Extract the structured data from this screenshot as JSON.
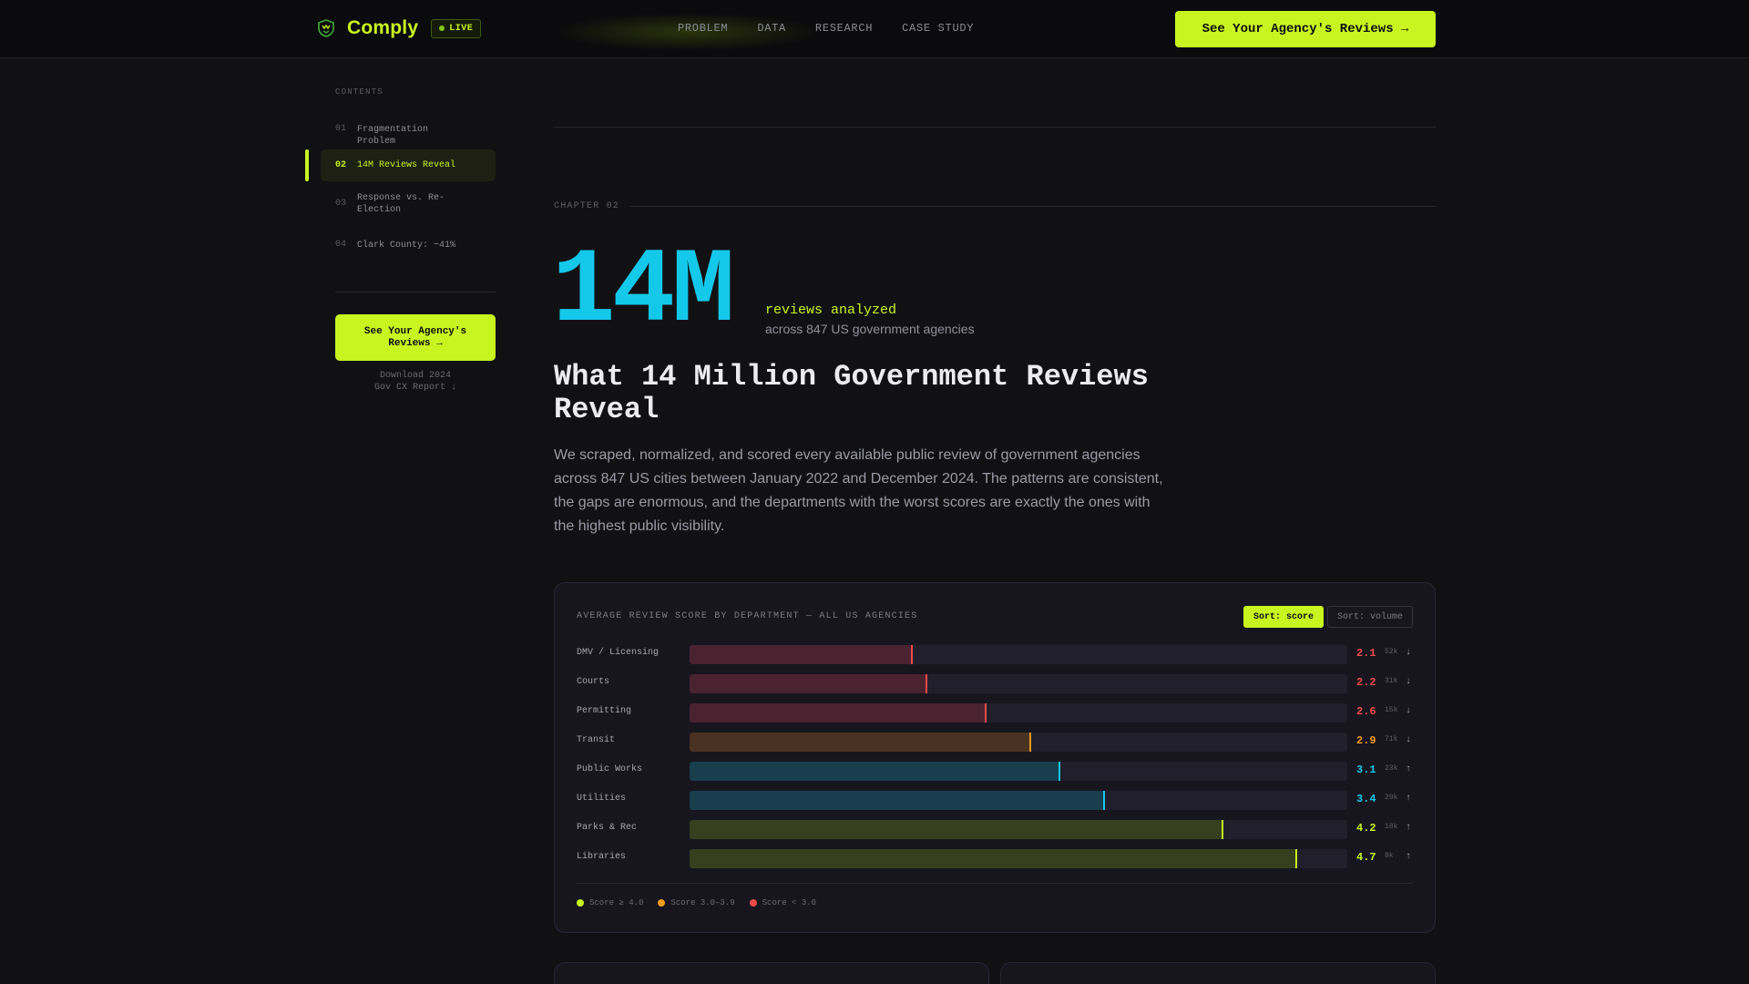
{
  "nav": {
    "brand": "Comply",
    "live_label": "LIVE",
    "links": [
      "PROBLEM",
      "DATA",
      "RESEARCH",
      "CASE STUDY"
    ],
    "cta": "See Your Agency's Reviews →"
  },
  "sidebar": {
    "contents_label": "CONTENTS",
    "items": [
      {
        "num": "01",
        "label": "Fragmentation Problem"
      },
      {
        "num": "02",
        "label": "14M Reviews Reveal"
      },
      {
        "num": "03",
        "label": "Response vs. Re-Election"
      },
      {
        "num": "04",
        "label": "Clark County: −41%"
      }
    ],
    "active_index": 1,
    "cta": "See Your Agency's Reviews →",
    "download": "Download 2024 Gov CX Report ↓"
  },
  "main": {
    "chapter": "CHAPTER 02",
    "big_number": "14M",
    "big_sub1": "reviews analyzed",
    "big_sub2": "across 847 US government agencies",
    "headline": "What 14 Million Government Reviews Reveal",
    "lede": "We scraped, normalized, and scored every available public review of government agencies across 847 US cities between January 2022 and December 2024. The patterns are consistent, the gaps are enormous, and the departments with the worst scores are exactly the ones with the highest public visibility."
  },
  "chart_card": {
    "title": "AVERAGE REVIEW SCORE BY DEPARTMENT — ALL US AGENCIES",
    "sort_score": "Sort: score",
    "sort_volume": "Sort: volume",
    "legend": [
      {
        "label": "Score ≥ 4.0",
        "color": "#c8f520"
      },
      {
        "label": "Score 3.0–3.9",
        "color": "#f39a1e"
      },
      {
        "label": "Score < 3.0",
        "color": "#ef4a4a"
      }
    ]
  },
  "colors": {
    "low": "#ef4a4a",
    "mid": "#f39a1e",
    "cyan": "#14c8ea",
    "high": "#c8f520"
  },
  "chart_data": {
    "type": "bar",
    "title": "AVERAGE REVIEW SCORE BY DEPARTMENT — ALL US AGENCIES",
    "orientation": "horizontal",
    "xlim": [
      0,
      5
    ],
    "categories": [
      "DMV / Licensing",
      "Courts",
      "Permitting",
      "Transit",
      "Public Works",
      "Utilities",
      "Parks & Rec",
      "Libraries"
    ],
    "values": [
      2.1,
      2.2,
      2.6,
      2.9,
      3.1,
      3.4,
      4.2,
      4.7
    ],
    "volumes": [
      "52k",
      "31k",
      "15k",
      "71k",
      "23k",
      "29k",
      "18k",
      "8k"
    ],
    "trends": [
      "↓",
      "↓",
      "↓",
      "↓",
      "↑",
      "↑",
      "↑",
      "↑"
    ],
    "tiers": [
      "low",
      "low",
      "low",
      "mid",
      "cyan",
      "cyan",
      "high",
      "high"
    ],
    "grid": false
  }
}
